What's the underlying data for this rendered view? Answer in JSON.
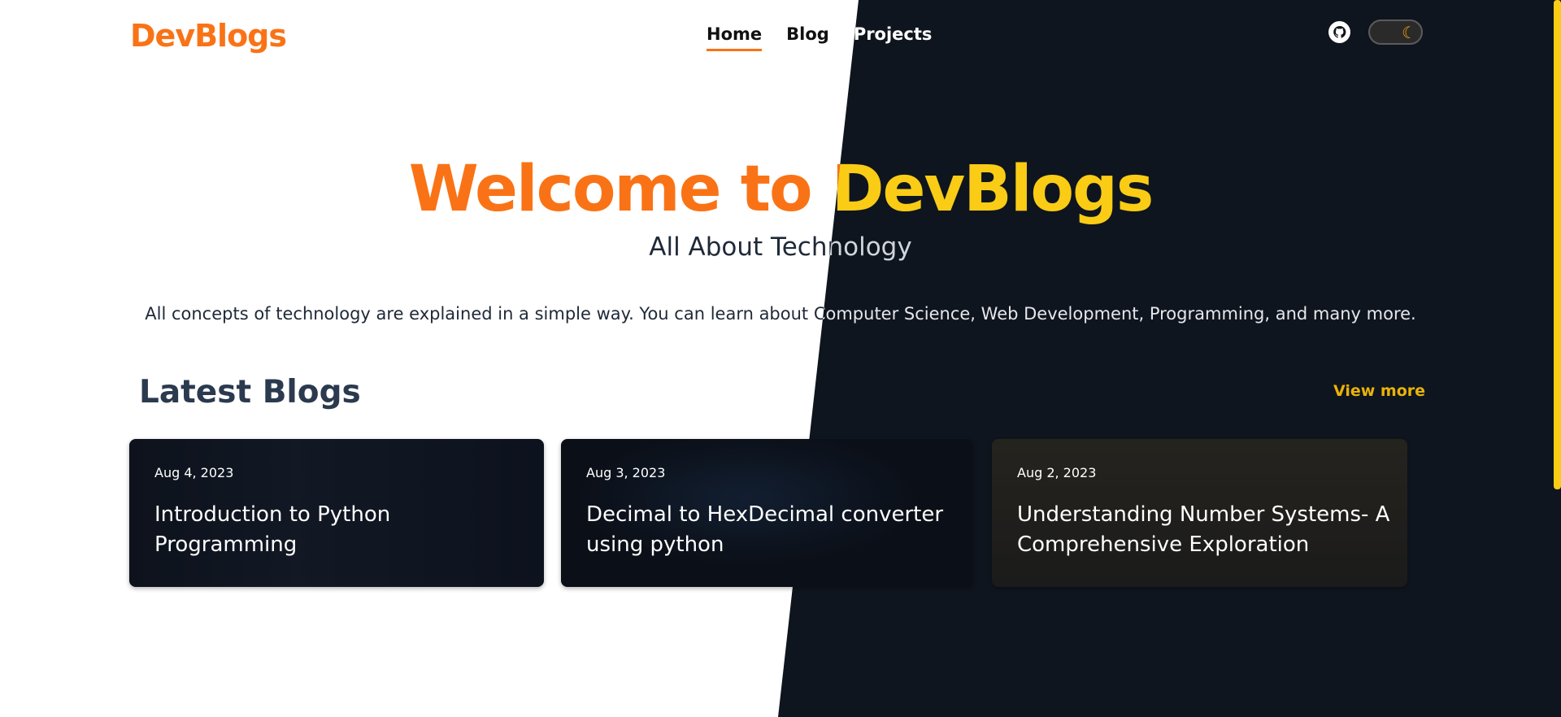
{
  "header": {
    "logo": "DevBlogs",
    "nav": [
      {
        "label": "Home",
        "active": true
      },
      {
        "label": "Blog"
      },
      {
        "label": "Projects"
      }
    ],
    "github_icon": "github-icon",
    "theme_toggle_icon": "moon-icon"
  },
  "hero": {
    "title": "Welcome to DevBlogs",
    "subtitle": "All About Technology",
    "description": "All concepts of technology are explained in a simple way. You can learn about Computer Science, Web Development, Programming, and many more."
  },
  "latest": {
    "heading": "Latest Blogs",
    "view_more": "View more",
    "posts": [
      {
        "date": "Aug 4, 2023",
        "title": "Introduction to Python Programming"
      },
      {
        "date": "Aug 3, 2023",
        "title": "Decimal to HexDecimal converter using python"
      },
      {
        "date": "Aug 2, 2023",
        "title": "Understanding Number Systems- A Comprehensive Exploration"
      }
    ]
  },
  "colors": {
    "accent": "#f97316",
    "dark_accent": "#facc15",
    "dark_bg": "#0f151e"
  }
}
